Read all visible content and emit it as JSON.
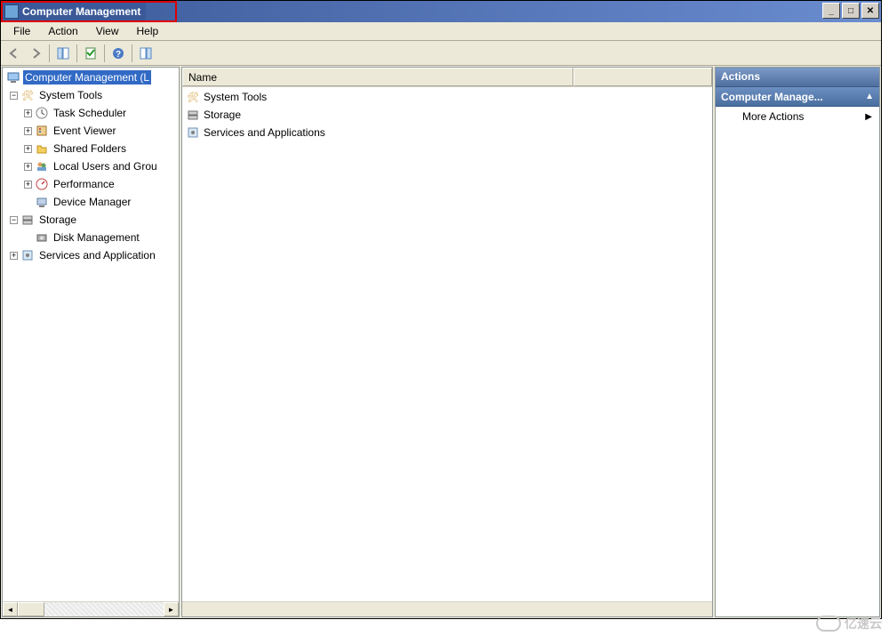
{
  "window": {
    "title": "Computer Management"
  },
  "menu": {
    "file": "File",
    "action": "Action",
    "view": "View",
    "help": "Help"
  },
  "tree": {
    "root": "Computer Management (L",
    "system_tools": "System Tools",
    "task_scheduler": "Task Scheduler",
    "event_viewer": "Event Viewer",
    "shared_folders": "Shared Folders",
    "local_users": "Local Users and Grou",
    "performance": "Performance",
    "device_manager": "Device Manager",
    "storage": "Storage",
    "disk_management": "Disk Management",
    "services_apps": "Services and Application"
  },
  "list": {
    "col_name": "Name",
    "items": {
      "system_tools": "System Tools",
      "storage": "Storage",
      "services_apps": "Services and Applications"
    }
  },
  "actions": {
    "title": "Actions",
    "group": "Computer Manage...",
    "more": "More Actions"
  },
  "watermark": "亿速云"
}
